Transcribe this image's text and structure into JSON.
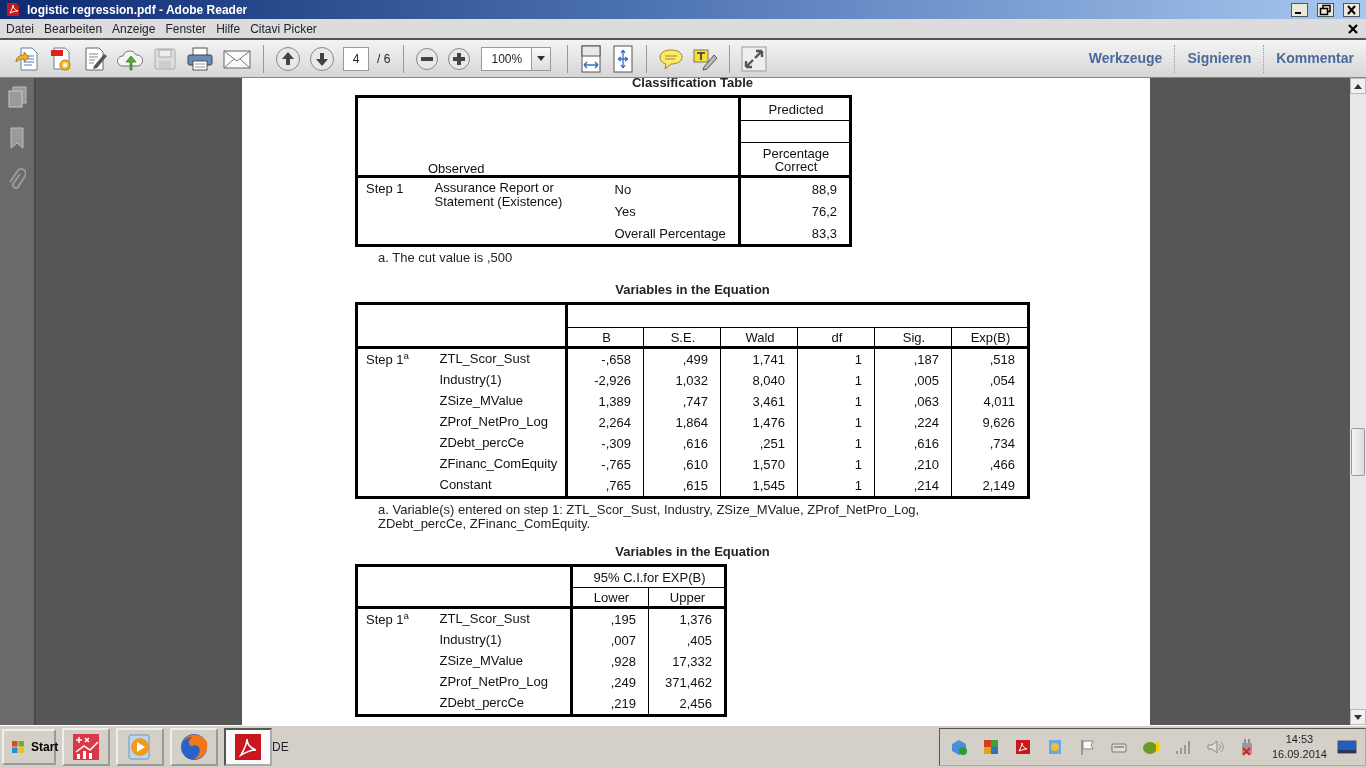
{
  "window": {
    "title": "logistic regression.pdf - Adobe Reader"
  },
  "menu": [
    {
      "label": "Datei"
    },
    {
      "label": "Bearbeiten"
    },
    {
      "label": "Anzeige"
    },
    {
      "label": "Fenster"
    },
    {
      "label": "Hilfe"
    },
    {
      "label": "Citavi Picker"
    }
  ],
  "toolbar": {
    "page": "4",
    "page_total": "/ 6",
    "zoom": "100%",
    "save_disabled": true,
    "panels": [
      {
        "label": "Werkzeuge"
      },
      {
        "label": "Signieren"
      },
      {
        "label": "Kommentar"
      }
    ]
  },
  "document": {
    "classification_table": {
      "title": "Classification Table",
      "predicted_header": "Predicted",
      "column_header": "Percentage Correct",
      "observed_header": "Observed",
      "step": "Step 1",
      "variable": "Assurance Report or Statement (Existence)",
      "rows": [
        {
          "category": "No",
          "value": "88,9"
        },
        {
          "category": "Yes",
          "value": "76,2"
        },
        {
          "category": "Overall Percentage",
          "value": "83,3"
        }
      ],
      "footnote": "a. The cut value is ,500"
    },
    "variables_table": {
      "title": "Variables in the Equation",
      "columns": [
        "B",
        "S.E.",
        "Wald",
        "df",
        "Sig.",
        "Exp(B)"
      ],
      "step": "Step 1$^{a}$",
      "rows": [
        {
          "name": "ZTL_Scor_Sust",
          "values": [
            "-,658",
            ",499",
            "1,741",
            "1",
            ",187",
            ",518"
          ]
        },
        {
          "name": "Industry(1)",
          "values": [
            "-2,926",
            "1,032",
            "8,040",
            "1",
            ",005",
            ",054"
          ]
        },
        {
          "name": "ZSize_MValue",
          "values": [
            "1,389",
            ",747",
            "3,461",
            "1",
            ",063",
            "4,011"
          ]
        },
        {
          "name": "ZProf_NetPro_Log",
          "values": [
            "2,264",
            "1,864",
            "1,476",
            "1",
            ",224",
            "9,626"
          ]
        },
        {
          "name": "ZDebt_percCe",
          "values": [
            "-,309",
            ",616",
            ",251",
            "1",
            ",616",
            ",734"
          ]
        },
        {
          "name": "ZFinanc_ComEquity",
          "values": [
            "-,765",
            ",610",
            "1,570",
            "1",
            ",210",
            ",466"
          ]
        },
        {
          "name": "Constant",
          "values": [
            ",765",
            ",615",
            "1,545",
            "1",
            ",214",
            "2,149"
          ]
        }
      ],
      "footnote": "a. Variable(s) entered on step 1: ZTL_Scor_Sust, Industry, ZSize_MValue, ZProf_NetPro_Log, ZDebt_percCe, ZFinanc_ComEquity."
    },
    "ci_table": {
      "title": "Variables in the Equation",
      "group_header": "95% C.I.for EXP(B)",
      "columns": [
        "Lower",
        "Upper"
      ],
      "step": "Step 1$^{a}$",
      "rows": [
        {
          "name": "ZTL_Scor_Sust",
          "values": [
            ",195",
            "1,376"
          ]
        },
        {
          "name": "Industry(1)",
          "values": [
            ",007",
            ",405"
          ]
        },
        {
          "name": "ZSize_MValue",
          "values": [
            ",928",
            "17,332"
          ]
        },
        {
          "name": "ZProf_NetPro_Log",
          "values": [
            ",249",
            "371,462"
          ]
        },
        {
          "name": "ZDebt_percCe",
          "values": [
            ",219",
            "2,456"
          ]
        }
      ]
    }
  },
  "taskbar": {
    "start": "Start",
    "language": "DE",
    "time": "14:53",
    "date": "16.09.2014",
    "apps": [
      {
        "kind": "calculator",
        "selected": false
      },
      {
        "kind": "media",
        "selected": false
      },
      {
        "kind": "browser",
        "selected": false
      },
      {
        "kind": "pdf",
        "selected": true
      }
    ]
  }
}
